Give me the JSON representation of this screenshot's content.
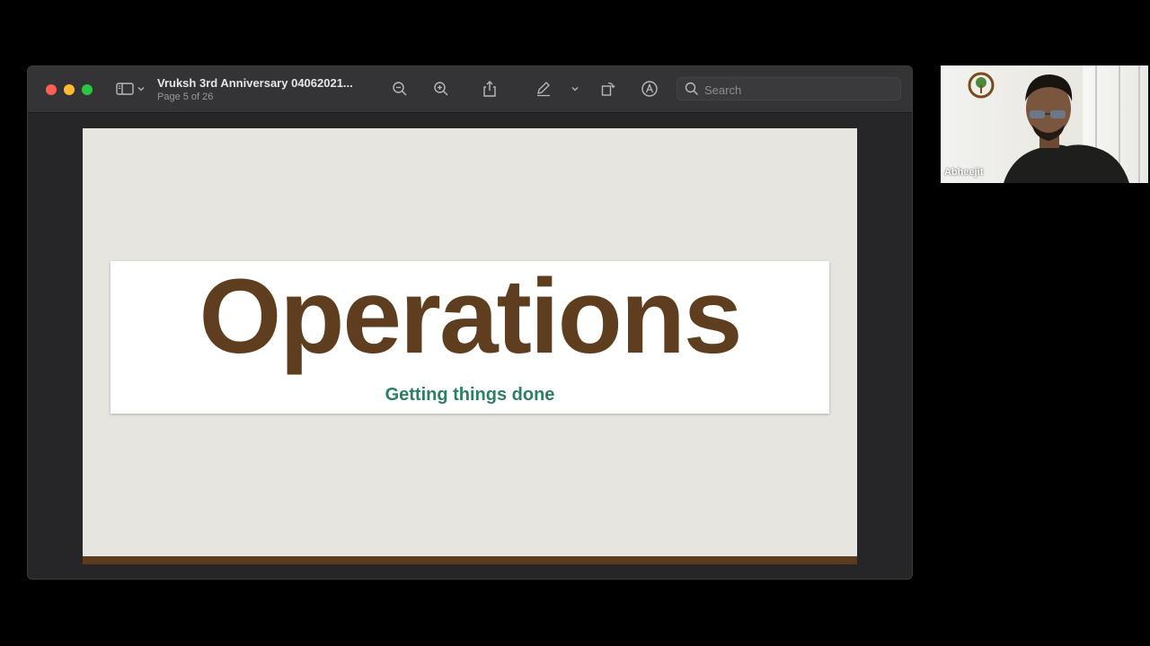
{
  "window": {
    "title": "Vruksh 3rd Anniversary 04062021...",
    "page_indicator": "Page 5 of 26",
    "search_placeholder": "Search"
  },
  "toolbar": {
    "icons": [
      "sidebar-icon",
      "chevron-down-icon",
      "zoom-out-icon",
      "zoom-in-icon",
      "share-icon",
      "markup-pen-icon",
      "chevron-down-icon",
      "rotate-icon",
      "annotate-icon",
      "search-icon"
    ]
  },
  "slide": {
    "title": "Operations",
    "subtitle": "Getting things done",
    "colors": {
      "title": "#5e3e1e",
      "subtitle": "#2e7e62",
      "bar": "#5c3c1c",
      "background": "#e6e5e0"
    }
  },
  "participant": {
    "name": "Abheejit"
  }
}
